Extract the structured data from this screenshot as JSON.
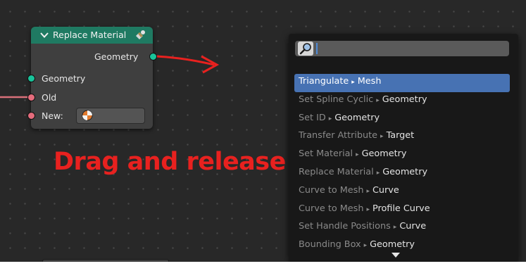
{
  "node": {
    "title": "Replace Material",
    "output_geometry": "Geometry",
    "input_geometry": "Geometry",
    "input_old": "Old",
    "input_new": "New:"
  },
  "annotation": {
    "text": "Drag and release",
    "color": "#e8211f"
  },
  "search_menu": {
    "query": "",
    "placeholder": "",
    "separator": "▸",
    "items": [
      {
        "name": "Triangulate",
        "target": "Mesh",
        "active": true
      },
      {
        "name": "Set Spline Cyclic",
        "target": "Geometry",
        "active": false
      },
      {
        "name": "Set ID",
        "target": "Geometry",
        "active": false
      },
      {
        "name": "Transfer Attribute",
        "target": "Target",
        "active": false
      },
      {
        "name": "Set Material",
        "target": "Geometry",
        "active": false
      },
      {
        "name": "Replace Material",
        "target": "Geometry",
        "active": false
      },
      {
        "name": "Curve to Mesh",
        "target": "Curve",
        "active": false
      },
      {
        "name": "Curve to Mesh",
        "target": "Profile Curve",
        "active": false
      },
      {
        "name": "Set Handle Positions",
        "target": "Curve",
        "active": false
      },
      {
        "name": "Bounding Box",
        "target": "Geometry",
        "active": false
      }
    ]
  },
  "colors": {
    "node_header": "#1f7a62",
    "geometry_socket": "#19c39a",
    "material_socket": "#e56c7c",
    "highlight": "#4772b3",
    "link_wire": "#d9707a"
  },
  "icons": {
    "collapse": "chevron-down-icon",
    "node_type": "material-node-icon",
    "material": "material-sphere-icon",
    "search": "magnifier-icon",
    "more": "triangle-down-icon"
  }
}
